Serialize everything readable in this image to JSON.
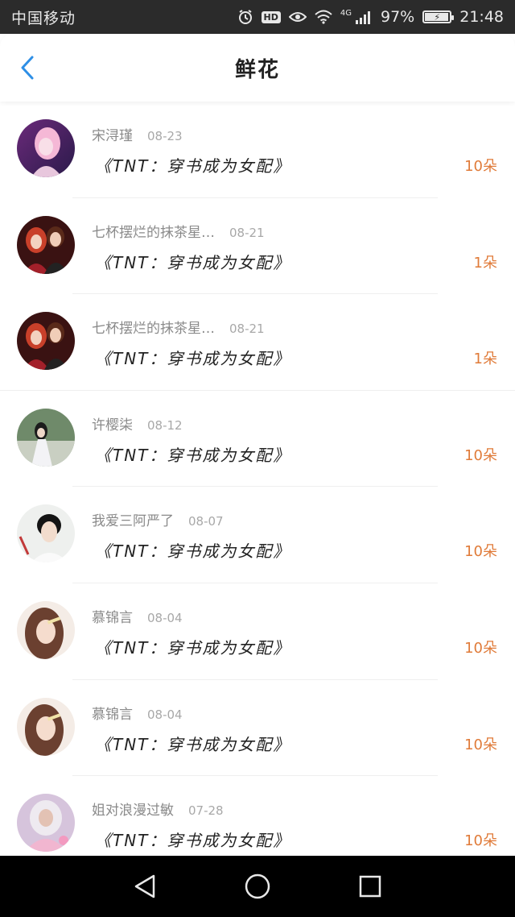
{
  "status_bar": {
    "carrier": "中国移动",
    "network": "4G",
    "battery_percent": "97%",
    "battery_level": 0.97,
    "time": "21:48",
    "hd_label": "HD"
  },
  "header": {
    "title": "鲜花"
  },
  "items": [
    {
      "name": "宋浔瑾",
      "date": "08-23",
      "book": "《TNT：穿书成为女配》",
      "amount": "10朵"
    },
    {
      "name": "七杯摆烂的抹茶星…",
      "date": "08-21",
      "book": "《TNT：穿书成为女配》",
      "amount": "1朵"
    },
    {
      "name": "七杯摆烂的抹茶星…",
      "date": "08-21",
      "book": "《TNT：穿书成为女配》",
      "amount": "1朵"
    },
    {
      "name": "许樱柒",
      "date": "08-12",
      "book": "《TNT：穿书成为女配》",
      "amount": "10朵"
    },
    {
      "name": "我爱三阿严了",
      "date": "08-07",
      "book": "《TNT：穿书成为女配》",
      "amount": "10朵"
    },
    {
      "name": "慕锦言",
      "date": "08-04",
      "book": "《TNT：穿书成为女配》",
      "amount": "10朵"
    },
    {
      "name": "慕锦言",
      "date": "08-04",
      "book": "《TNT：穿书成为女配》",
      "amount": "10朵"
    },
    {
      "name": "姐对浪漫过敏",
      "date": "07-28",
      "book": "《TNT：穿书成为女配》",
      "amount": "10朵"
    }
  ],
  "colors": {
    "accent_back": "#2e8fe6",
    "amount": "#e07b39",
    "status_bg": "#2b2b2b",
    "nav_bg": "#000000"
  },
  "icons": {
    "back": "chevron-left-icon",
    "nav_back": "triangle-back-icon",
    "nav_home": "circle-home-icon",
    "nav_recents": "square-recents-icon"
  }
}
